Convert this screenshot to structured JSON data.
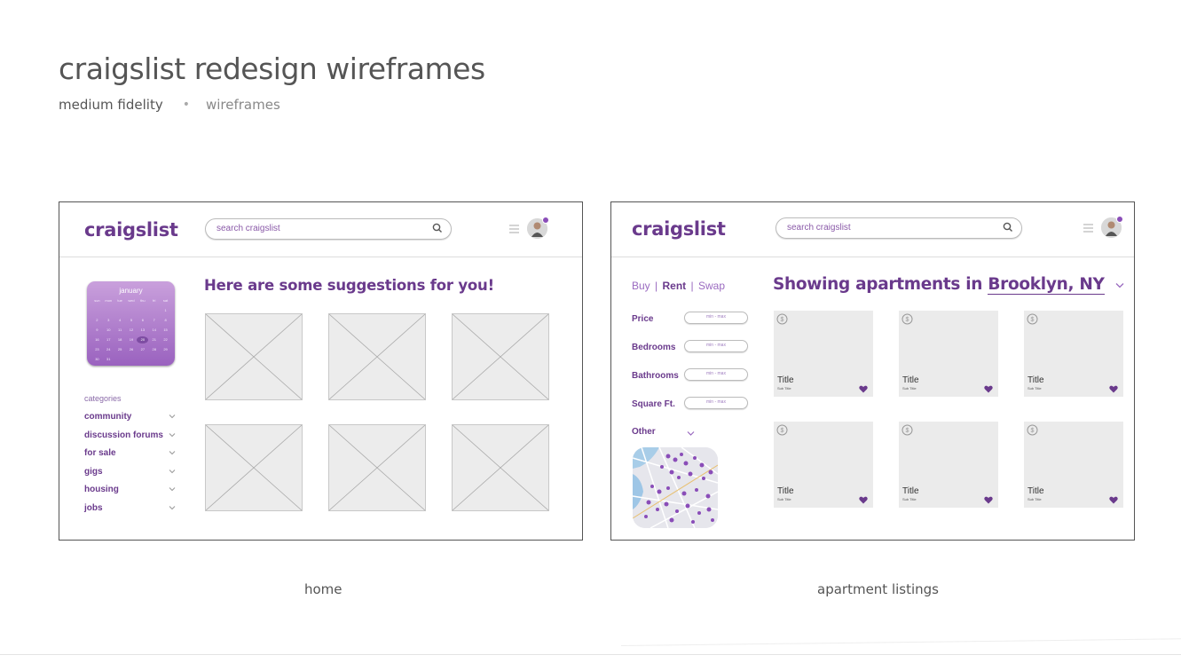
{
  "page": {
    "title": "craigslist redesign wireframes",
    "subtitle_left": "medium fidelity",
    "subtitle_sep": "•",
    "subtitle_right": "wireframes"
  },
  "captions": {
    "home": "home",
    "apartments": "apartment listings"
  },
  "header": {
    "logo": "craigslist",
    "search_placeholder": "search craigslist",
    "icons": [
      "search-icon",
      "hamburger-menu-icon",
      "avatar",
      "notification-dot"
    ]
  },
  "home": {
    "calendar": {
      "month": "january",
      "weekdays": [
        "sun",
        "mon",
        "tue",
        "wed",
        "thu",
        "fri",
        "sat"
      ],
      "days": [
        "",
        "",
        "",
        "",
        "",
        "",
        "1",
        "2",
        "3",
        "4",
        "5",
        "6",
        "7",
        "8",
        "9",
        "10",
        "11",
        "12",
        "13",
        "14",
        "15",
        "16",
        "17",
        "18",
        "19",
        "20",
        "21",
        "22",
        "23",
        "24",
        "25",
        "26",
        "27",
        "28",
        "29",
        "30",
        "31",
        "",
        "",
        "",
        "",
        ""
      ],
      "today": "20"
    },
    "categories_label": "categories",
    "categories": [
      "community",
      "discussion forums",
      "for sale",
      "gigs",
      "housing",
      "jobs"
    ],
    "suggestions_heading": "Here are some suggestions for you!"
  },
  "apartments": {
    "tabs": {
      "buy": "Buy",
      "rent": "Rent",
      "swap": "Swap",
      "sep": "|"
    },
    "filters": [
      {
        "label": "Price",
        "placeholder": "min - max"
      },
      {
        "label": "Bedrooms",
        "placeholder": "min - max"
      },
      {
        "label": "Bathrooms",
        "placeholder": "min - max"
      },
      {
        "label": "Square Ft.",
        "placeholder": "min - max"
      }
    ],
    "other_label": "Other",
    "heading_prefix": "Showing apartments in",
    "location": "Brooklyn, NY",
    "listings": [
      {
        "title": "Title",
        "subtitle": "Sub Title"
      },
      {
        "title": "Title",
        "subtitle": "Sub Title"
      },
      {
        "title": "Title",
        "subtitle": "Sub Title"
      },
      {
        "title": "Title",
        "subtitle": "Sub Title"
      },
      {
        "title": "Title",
        "subtitle": "Sub Title"
      },
      {
        "title": "Title",
        "subtitle": "Sub Title"
      }
    ]
  },
  "colors": {
    "brand_purple": "#6a3a8c",
    "accent_purple": "#8a4db8",
    "placeholder_gray": "#ebebeb"
  }
}
